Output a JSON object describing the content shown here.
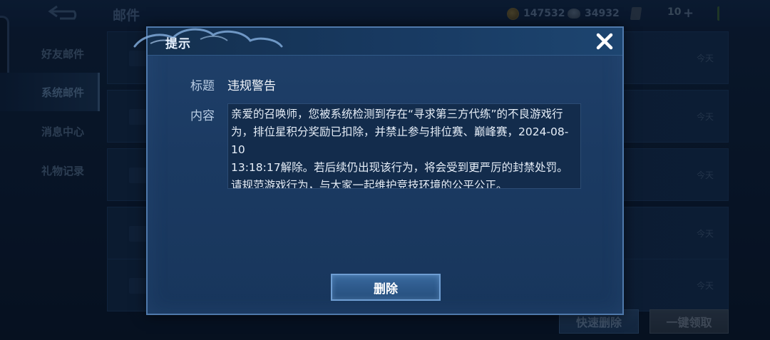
{
  "background": {
    "page_title": "邮件",
    "currency": {
      "gold": "147532",
      "diamonds": "34932",
      "stamina": "10"
    },
    "sidebar": {
      "items": [
        {
          "label": "好友邮件",
          "active": false
        },
        {
          "label": "系统邮件",
          "active": true
        },
        {
          "label": "消息中心",
          "active": false
        },
        {
          "label": "礼物记录",
          "active": false
        }
      ]
    },
    "mail_dates": [
      "今天",
      "今天",
      "今天",
      "今天",
      "今天",
      "今天"
    ],
    "buttons": {
      "quick_delete": "快速删除",
      "claim_all": "一键领取"
    }
  },
  "dialog": {
    "title": "提示",
    "subject_label": "标题",
    "subject_value": "违规警告",
    "content_label": "内容",
    "content_text": "亲爱的召唤师，您被系统检测到存在“寻求第三方代练”的不良游戏行为，排位星积分奖励已扣除，并禁止参与排位赛、巅峰赛，2024-08-10\n13:18:17解除。若后续仍出现该行为，将会受到更严厉的封禁处罚。请规范游戏行为，与大家一起维护竞技环境的公平公正。",
    "delete_label": "删除"
  },
  "colors": {
    "dialog_bg": "#1d3d66",
    "dialog_border": "#4f79ab",
    "accent_button": "#3b6b9f"
  },
  "icons": {
    "close": "close-icon",
    "back": "back-icon",
    "gold": "coin-icon",
    "diamond": "gem-icon"
  }
}
